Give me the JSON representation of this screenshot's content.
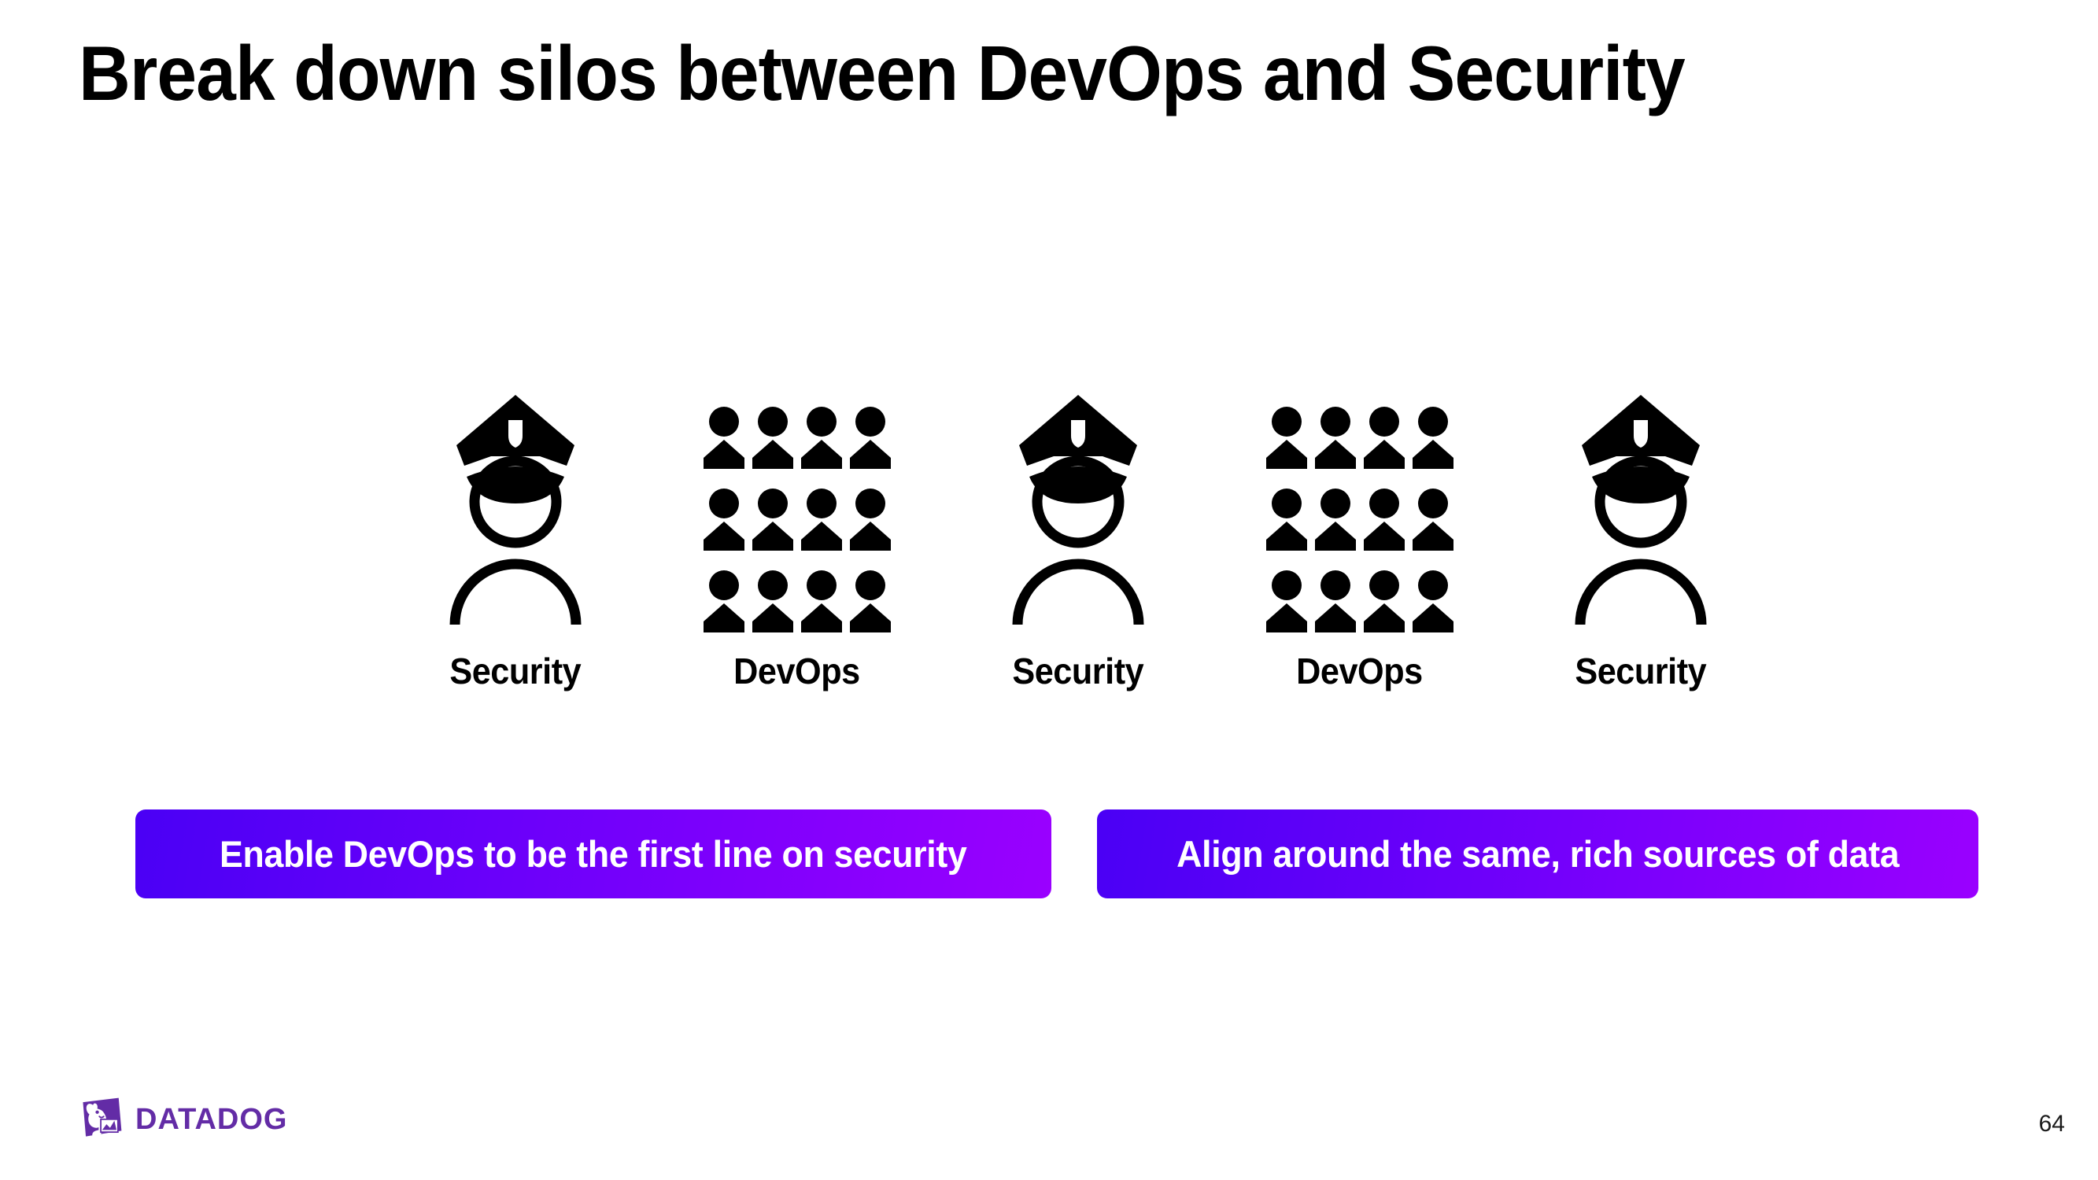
{
  "slide": {
    "title": "Break down silos between DevOps and Security",
    "page_number": "64",
    "background_color": "#ffffff"
  },
  "diagram": {
    "groups": [
      {
        "label": "Security",
        "icon": "security-officer-icon",
        "type": "officer",
        "count": 1
      },
      {
        "label": "DevOps",
        "icon": "person-icon",
        "type": "people",
        "count": 12,
        "columns": 4,
        "rows": 3
      },
      {
        "label": "Security",
        "icon": "security-officer-icon",
        "type": "officer",
        "count": 1
      },
      {
        "label": "DevOps",
        "icon": "person-icon",
        "type": "people",
        "count": 12,
        "columns": 4,
        "rows": 3
      },
      {
        "label": "Security",
        "icon": "security-officer-icon",
        "type": "officer",
        "count": 1
      }
    ],
    "icon_color": "#000000"
  },
  "callouts": [
    {
      "label": "Enable DevOps to be the first line on security"
    },
    {
      "label": "Align around the same, rich sources of data"
    }
  ],
  "theme": {
    "gradient_start": "#4A00F5",
    "gradient_end": "#9A00FF",
    "button_text_color": "#ffffff",
    "brand_purple": "#632CA6"
  },
  "footer": {
    "logo_text": "DATADOG",
    "logo_icon": "datadog-dog-icon"
  }
}
